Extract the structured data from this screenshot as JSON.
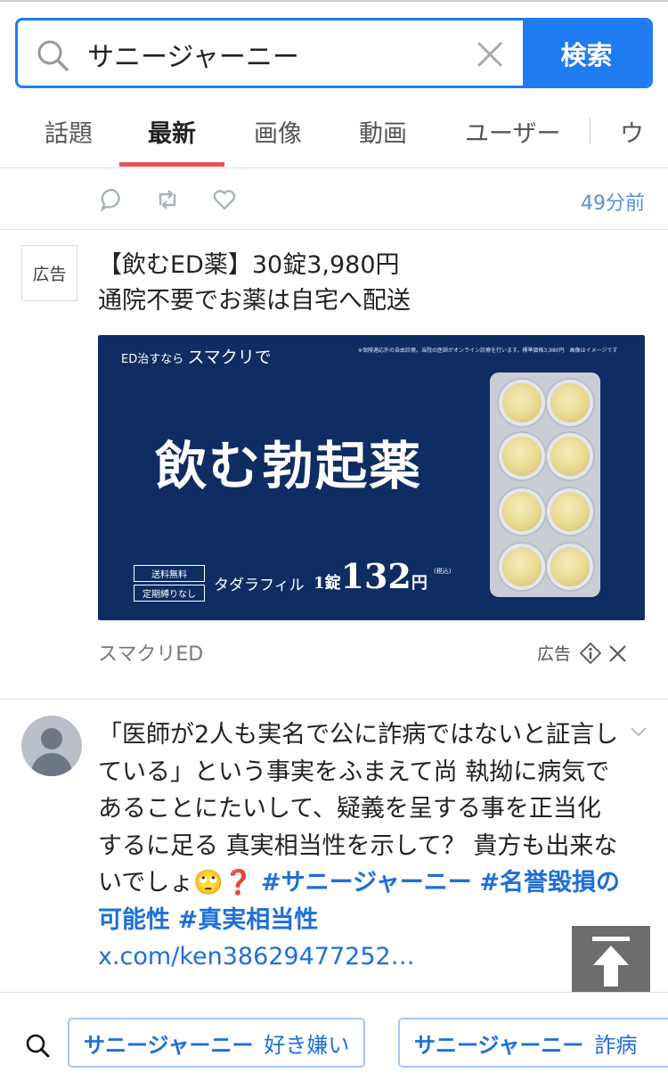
{
  "search": {
    "value": "サニージャーニー",
    "button_label": "検索"
  },
  "tabs": [
    {
      "label": "話題",
      "active": false
    },
    {
      "label": "最新",
      "active": true
    },
    {
      "label": "画像",
      "active": false
    },
    {
      "label": "動画",
      "active": false
    },
    {
      "label": "ユーザー",
      "active": false
    },
    {
      "label": "ウ",
      "active": false
    }
  ],
  "previous_tweet": {
    "time": "49分前",
    "icons": [
      "reply-icon",
      "retweet-icon",
      "like-icon"
    ]
  },
  "ad": {
    "badge": "広告",
    "title": "【飲むED薬】30錠3,980円",
    "subtitle": "通院不要でお薬は自宅へ配送",
    "banner": {
      "lead_small": "ED治すなら",
      "lead_large": "スマクリで",
      "note": "※保険適応外の自由診療。当院の医師がオンライン診療を行います。標準価格3,980円　画像はイメージです",
      "headline": "飲む勃起薬",
      "tags": [
        "送料無料",
        "定期縛りなし"
      ],
      "price_label": "タダラフィル",
      "price_prefix": "1錠",
      "price_value": "132",
      "price_unit": "円",
      "tax_note": "(税込)"
    },
    "source": "スマクリED",
    "label": "広告"
  },
  "tweet": {
    "text": "「医師が2人も実名で公に詐病ではないと証言している」という事実をふまえて尚 執拗に病気であることにたいして、疑義を呈する事を正当化するに足る 真実相当性を示して？ 貴方も出来ないでしょ",
    "emoji": "🙄❓",
    "hashtags": [
      "#サニージャーニー",
      "#名誉毀損の可能性",
      "#真実相当性"
    ],
    "link": "x.com/ken38629477252…"
  },
  "suggestions": [
    {
      "keyword": "サニージャーニー",
      "suffix": "好き嫌い"
    },
    {
      "keyword": "サニージャーニー",
      "suffix": "詐病"
    }
  ],
  "colors": {
    "accent": "#1e7bf2",
    "active_tab_underline": "#e8535b",
    "banner_bg": "#0f2c63",
    "link": "#1e6fd8"
  }
}
